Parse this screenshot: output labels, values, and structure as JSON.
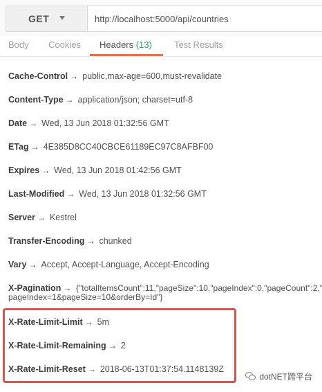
{
  "request": {
    "method": "GET",
    "url": "http://localhost:5000/api/countries"
  },
  "tabs": [
    {
      "label": "Body"
    },
    {
      "label": "Cookies"
    },
    {
      "label": "Headers",
      "count": "(13)",
      "active": true
    },
    {
      "label": "Test Results"
    }
  ],
  "headers": [
    {
      "key": "Cache-Control",
      "value": "public,max-age=600,must-revalidate"
    },
    {
      "key": "Content-Type",
      "value": "application/json; charset=utf-8"
    },
    {
      "key": "Date",
      "value": "Wed, 13 Jun 2018 01:32:56 GMT"
    },
    {
      "key": "ETag",
      "value": "4E385D8CC40CBCE61189EC97C8AFBF00"
    },
    {
      "key": "Expires",
      "value": "Wed, 13 Jun 2018 01:42:56 GMT"
    },
    {
      "key": "Last-Modified",
      "value": "Wed, 13 Jun 2018 01:32:56 GMT"
    },
    {
      "key": "Server",
      "value": "Kestrel"
    },
    {
      "key": "Transfer-Encoding",
      "value": "chunked"
    },
    {
      "key": "Vary",
      "value": "Accept, Accept-Language, Accept-Encoding"
    },
    {
      "key": "X-Pagination",
      "value": "{\"totalItemsCount\":11,\"pageSize\":10,\"pageIndex\":0,\"pageCount\":2,\"",
      "value_line2": "pageIndex=1&pageSize=10&orderBy=Id\"}"
    },
    {
      "key": "X-Rate-Limit-Limit",
      "value": "5m"
    },
    {
      "key": "X-Rate-Limit-Remaining",
      "value": "2"
    },
    {
      "key": "X-Rate-Limit-Reset",
      "value": "2018-06-13T01:37:54.1148139Z"
    }
  ],
  "arrow": "→",
  "highlight_color": "#d9534f",
  "watermark": {
    "text": "dotNET跨平台",
    "icon": "wechat-icon"
  }
}
